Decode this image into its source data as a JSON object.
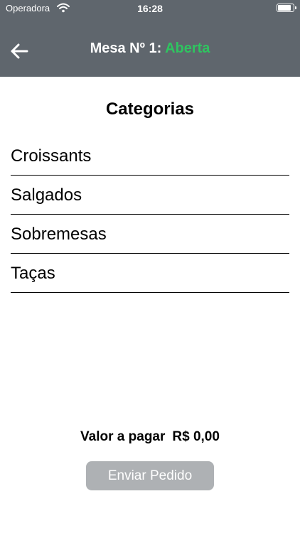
{
  "status_bar": {
    "carrier": "Operadora",
    "time": "16:28",
    "battery_level": 0.9
  },
  "header": {
    "back_icon": "arrow-left-icon",
    "title_prefix": "Mesa Nº 1: ",
    "table_status": "Aberta",
    "status_color": "#2fc460",
    "bar_color": "#5f666d"
  },
  "categories": {
    "title": "Categorias",
    "items": [
      {
        "label": "Croissants"
      },
      {
        "label": "Salgados"
      },
      {
        "label": "Sobremesas"
      },
      {
        "label": "Taças"
      }
    ]
  },
  "footer": {
    "total_label": "Valor a pagar",
    "total_value": "R$ 0,00",
    "send_button": "Enviar Pedido",
    "send_button_color": "#aeb1b4"
  }
}
